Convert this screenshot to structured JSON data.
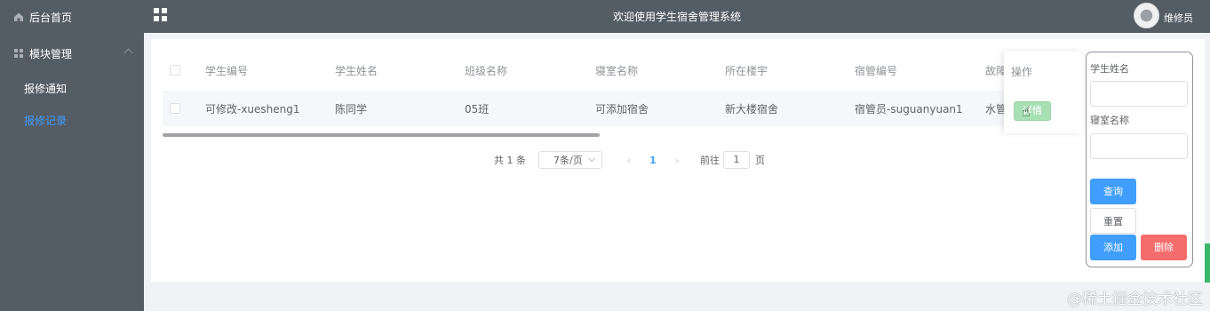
{
  "sidebar": {
    "home_label": "后台首页",
    "module_label": "模块管理",
    "items": [
      {
        "label": "报修通知"
      },
      {
        "label": "报修记录"
      }
    ]
  },
  "header": {
    "title": "欢迎使用学生宿舍管理系统",
    "user": "维修员"
  },
  "table": {
    "columns": [
      "学生编号",
      "学生姓名",
      "班级名称",
      "寝室名称",
      "所在楼宇",
      "宿管编号",
      "故障",
      "操作"
    ],
    "rows": [
      [
        "可修改-xuesheng1",
        "陈同学",
        "05班",
        "可添加宿舍",
        "新大楼宿舍",
        "宿管员-suguanyuan1",
        "水管"
      ]
    ],
    "action_label": "详情"
  },
  "pagination": {
    "total": "共 1 条",
    "page_size": "7条/页",
    "prev": "‹",
    "current": "1",
    "next": "›",
    "goto_label": "前往",
    "goto_value": "1",
    "page_unit": "页"
  },
  "search": {
    "student_name_label": "学生姓名",
    "dorm_name_label": "寝室名称",
    "query": "查询",
    "reset": "重置",
    "add": "添加",
    "delete": "删除"
  },
  "watermark": "@稀土掘金技术社区",
  "colors": {
    "primary": "#409eff",
    "danger": "#f56c6c",
    "sidebar": "#545c64"
  }
}
